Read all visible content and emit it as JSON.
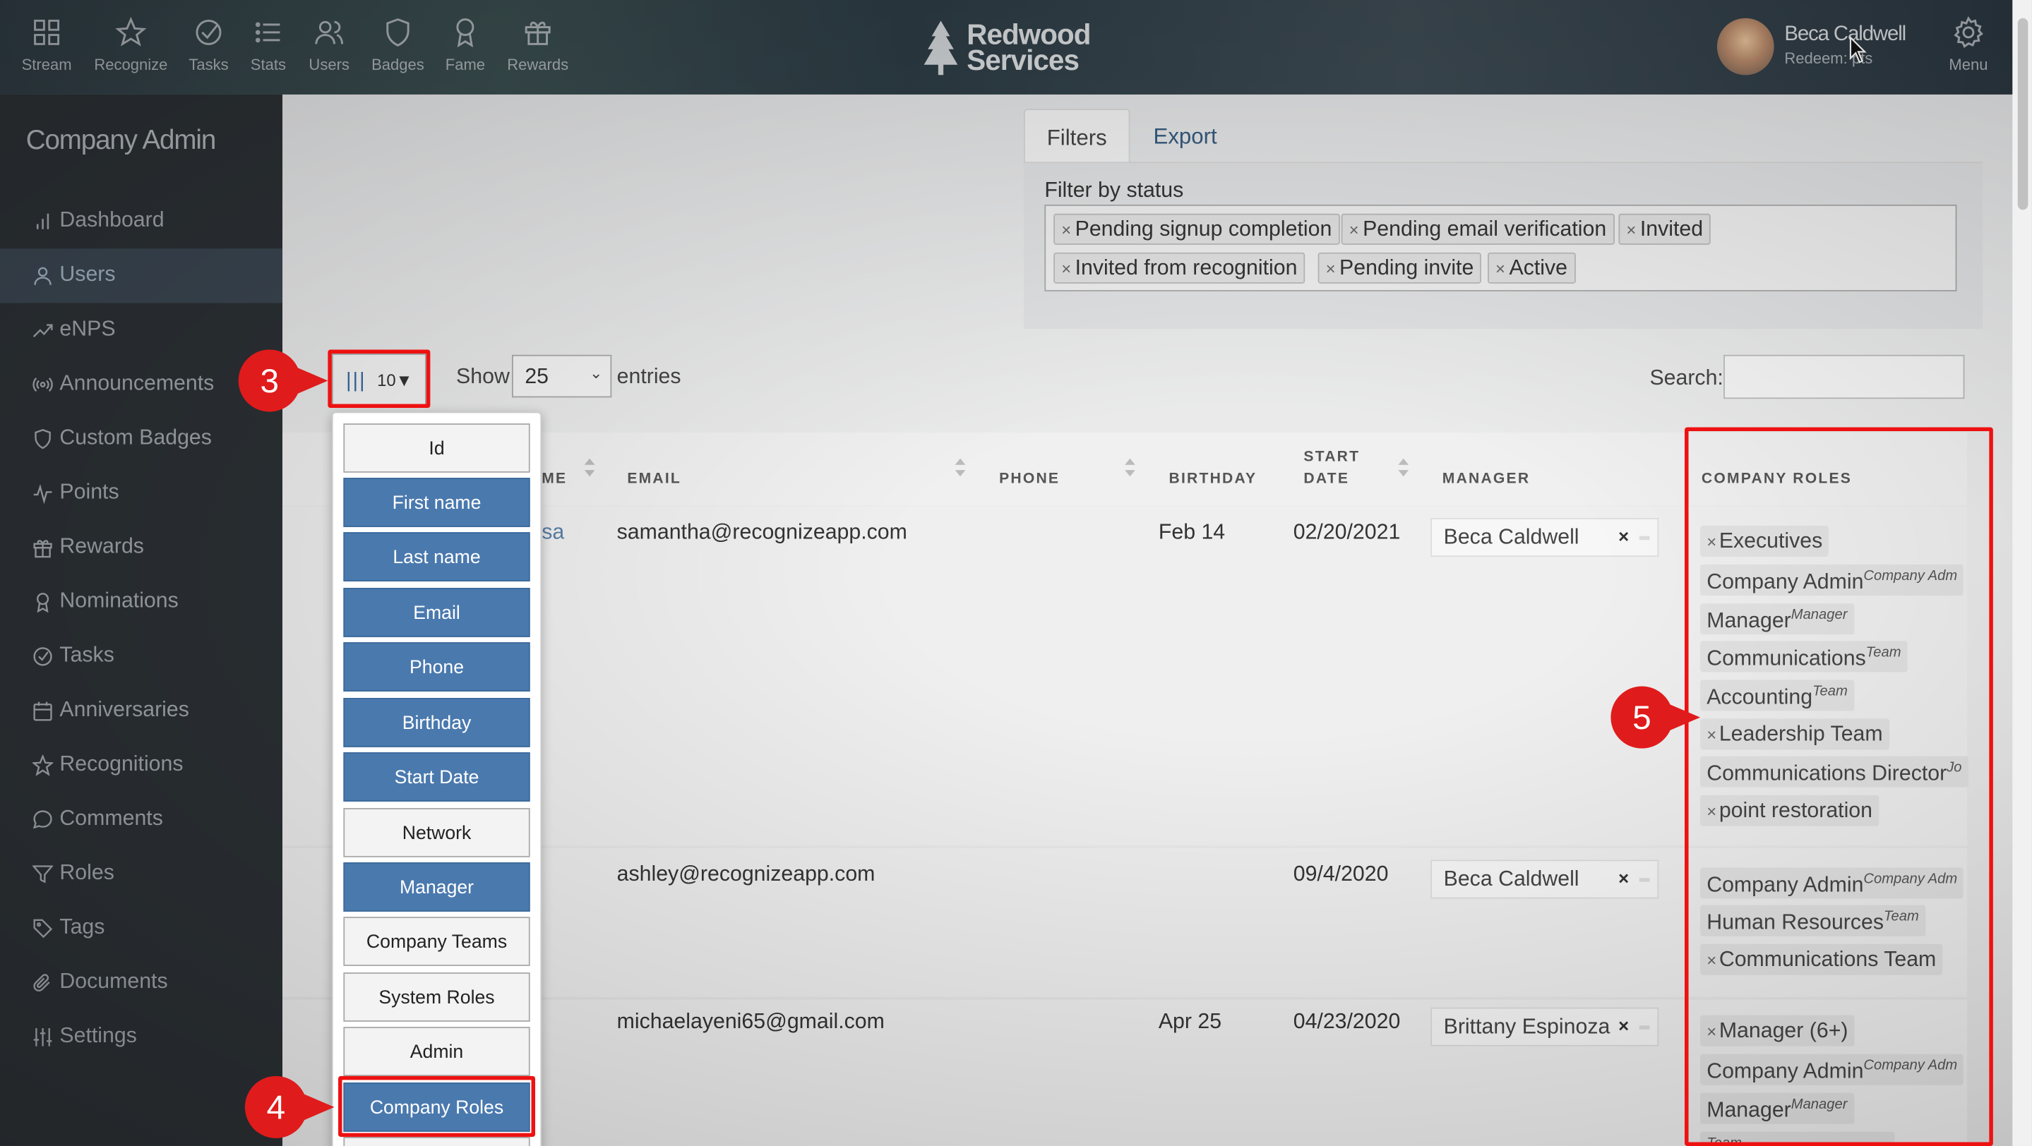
{
  "nav": {
    "items": [
      {
        "label": "Stream",
        "icon": "grid-icon"
      },
      {
        "label": "Recognize",
        "icon": "star-icon"
      },
      {
        "label": "Tasks",
        "icon": "check-circle-icon"
      },
      {
        "label": "Stats",
        "icon": "list-icon"
      },
      {
        "label": "Users",
        "icon": "users-icon"
      },
      {
        "label": "Badges",
        "icon": "shield-icon"
      },
      {
        "label": "Fame",
        "icon": "award-icon"
      },
      {
        "label": "Rewards",
        "icon": "gift-icon"
      }
    ],
    "brand_line1": "Redwood",
    "brand_line2": "Services",
    "user_name": "Beca Caldwell",
    "user_redeem": "Redeem: pts",
    "menu_label": "Menu"
  },
  "sidebar": {
    "title": "Company Admin",
    "items": [
      {
        "label": "Dashboard",
        "icon": "bar-chart-icon"
      },
      {
        "label": "Users",
        "icon": "user-icon",
        "active": true
      },
      {
        "label": "eNPS",
        "icon": "trend-icon"
      },
      {
        "label": "Announcements",
        "icon": "broadcast-icon"
      },
      {
        "label": "Custom Badges",
        "icon": "shield-icon"
      },
      {
        "label": "Points",
        "icon": "pulse-icon"
      },
      {
        "label": "Rewards",
        "icon": "gift-icon"
      },
      {
        "label": "Nominations",
        "icon": "award-icon"
      },
      {
        "label": "Tasks",
        "icon": "check-circle-icon"
      },
      {
        "label": "Anniversaries",
        "icon": "calendar-icon"
      },
      {
        "label": "Recognitions",
        "icon": "star-icon"
      },
      {
        "label": "Comments",
        "icon": "comment-icon"
      },
      {
        "label": "Roles",
        "icon": "filter-icon"
      },
      {
        "label": "Tags",
        "icon": "tag-icon"
      },
      {
        "label": "Documents",
        "icon": "paperclip-icon"
      },
      {
        "label": "Settings",
        "icon": "sliders-icon"
      }
    ]
  },
  "tabs": {
    "filters": "Filters",
    "export": "Export"
  },
  "filter": {
    "label": "Filter by status",
    "tags": [
      "Pending signup completion",
      "Pending email verification",
      "Invited",
      "Invited from recognition",
      "Pending invite",
      "Active"
    ]
  },
  "controls": {
    "columns_count": "10",
    "show_label": "Show",
    "show_value": "25",
    "entries_label": "entries",
    "search_label": "Search:",
    "search_value": ""
  },
  "columns_menu": [
    {
      "label": "Id",
      "on": false
    },
    {
      "label": "First name",
      "on": true
    },
    {
      "label": "Last name",
      "on": true
    },
    {
      "label": "Email",
      "on": true
    },
    {
      "label": "Phone",
      "on": true
    },
    {
      "label": "Birthday",
      "on": true
    },
    {
      "label": "Start Date",
      "on": true
    },
    {
      "label": "Network",
      "on": false
    },
    {
      "label": "Manager",
      "on": true
    },
    {
      "label": "Company Teams",
      "on": false
    },
    {
      "label": "System Roles",
      "on": false
    },
    {
      "label": "Admin",
      "on": false
    },
    {
      "label": "Company Roles",
      "on": true
    }
  ],
  "table": {
    "headers": {
      "name_partial": "ME",
      "email": "EMAIL",
      "phone": "PHONE",
      "birthday": "BIRTHDAY",
      "start_line1": "START",
      "start_line2": "DATE",
      "manager": "MANAGER",
      "company_roles": "COMPANY ROLES"
    },
    "rows": [
      {
        "name_partial": "sa",
        "email": "samantha@recognizeapp.com",
        "birthday": "Feb 14",
        "start_date": "02/20/2021",
        "manager": "Beca Caldwell",
        "roles": [
          {
            "label": "Executives",
            "x": true,
            "sup": ""
          },
          {
            "label": "Company Admin",
            "x": false,
            "sup": "Company Adm"
          },
          {
            "label": "Manager",
            "x": false,
            "sup": "Manager"
          },
          {
            "label": "Communications",
            "x": false,
            "sup": "Team"
          },
          {
            "label": "Accounting",
            "x": false,
            "sup": "Team"
          },
          {
            "label": "Leadership Team",
            "x": true,
            "sup": ""
          },
          {
            "label": "Communications Director",
            "x": false,
            "sup": "Jo"
          },
          {
            "label": "point restoration",
            "x": true,
            "sup": ""
          }
        ]
      },
      {
        "name_partial": "",
        "email": "ashley@recognizeapp.com",
        "birthday": "",
        "start_date": "09/4/2020",
        "manager": "Beca Caldwell",
        "roles": [
          {
            "label": "Company Admin",
            "x": false,
            "sup": "Company Adm"
          },
          {
            "label": "Human Resources",
            "x": false,
            "sup": "Team"
          },
          {
            "label": "Communications Team",
            "x": true,
            "sup": ""
          }
        ]
      },
      {
        "name_partial": "",
        "email": "michaelayeni65@gmail.com",
        "birthday": "Apr 25",
        "start_date": "04/23/2020",
        "manager": "Brittany Espinoza",
        "roles": [
          {
            "label": "Manager (6+)",
            "x": true,
            "sup": ""
          },
          {
            "label": "Company Admin",
            "x": false,
            "sup": "Company Adm"
          },
          {
            "label": "Manager",
            "x": false,
            "sup": "Manager"
          },
          {
            "label": "",
            "x": false,
            "sup": "Team"
          }
        ]
      }
    ]
  },
  "annotations": {
    "m3": "3",
    "m4": "4",
    "m5": "5"
  },
  "colors": {
    "accent": "#4a79ae",
    "marker": "#e01b1b",
    "sidebar_bg": "#2b3034",
    "link": "#355a7e"
  }
}
